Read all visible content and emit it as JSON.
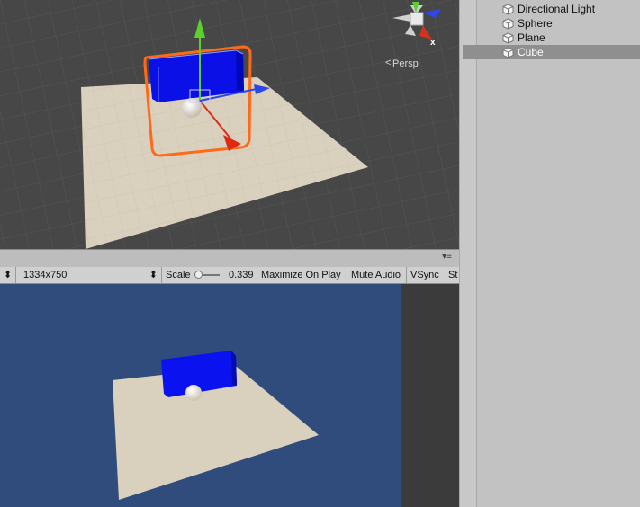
{
  "scene": {
    "camera_label": "Persp",
    "gizmo_axis_x": "x"
  },
  "game_toolbar": {
    "resolution": "1334x750",
    "scale_label": "Scale",
    "scale_value": "0.339",
    "maximize_on_play": "Maximize On Play",
    "mute_audio": "Mute Audio",
    "vsync": "VSync",
    "stats_partial": "St"
  },
  "hierarchy": {
    "items": [
      {
        "label": "Directional Light",
        "selected": false
      },
      {
        "label": "Sphere",
        "selected": false
      },
      {
        "label": "Plane",
        "selected": false
      },
      {
        "label": "Cube",
        "selected": true
      }
    ]
  },
  "colors": {
    "scene_bg": "#474747",
    "game_bg": "#2f4c7c",
    "cube_blue": "#0a10e6",
    "selection_orange": "#ff6a1a",
    "plane": "#d8d0bc"
  }
}
